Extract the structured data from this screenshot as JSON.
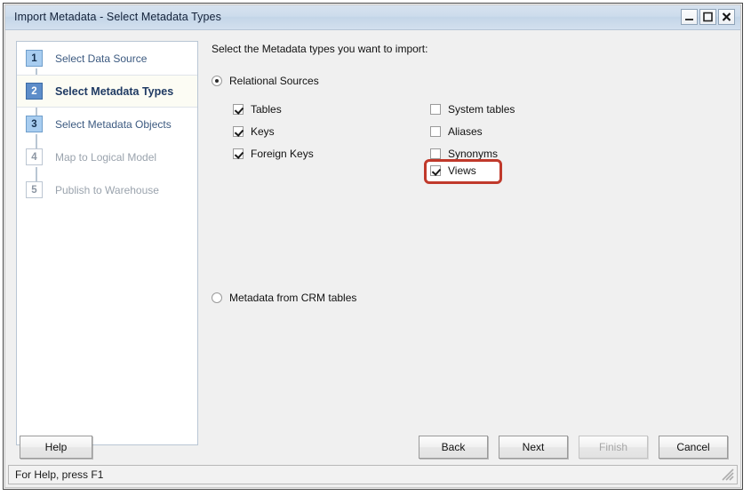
{
  "window": {
    "title": "Import Metadata - Select Metadata Types",
    "minimize_label": "Minimize",
    "maximize_label": "Maximize",
    "close_label": "Close"
  },
  "steps": [
    {
      "number": "1",
      "label": "Select Data Source",
      "state": "done"
    },
    {
      "number": "2",
      "label": "Select Metadata Types",
      "state": "active"
    },
    {
      "number": "3",
      "label": "Select Metadata Objects",
      "state": "done"
    },
    {
      "number": "4",
      "label": "Map to Logical Model",
      "state": "upcoming"
    },
    {
      "number": "5",
      "label": "Publish to Warehouse",
      "state": "upcoming"
    }
  ],
  "main": {
    "instruction": "Select the Metadata types you want to import:",
    "radios": [
      {
        "label": "Relational Sources",
        "checked": true
      },
      {
        "label": "Metadata from CRM tables",
        "checked": false
      }
    ],
    "checkboxes_left": [
      {
        "label": "Tables",
        "checked": true
      },
      {
        "label": "Keys",
        "checked": true
      },
      {
        "label": "Foreign Keys",
        "checked": true
      }
    ],
    "checkboxes_right": [
      {
        "label": "System tables",
        "checked": false
      },
      {
        "label": "Aliases",
        "checked": false
      },
      {
        "label": "Synonyms",
        "checked": false
      },
      {
        "label": "Views",
        "checked": true,
        "highlighted": true
      }
    ]
  },
  "buttons": {
    "help": {
      "label": "Help",
      "disabled": false
    },
    "back": {
      "label": "Back",
      "disabled": false
    },
    "next": {
      "label": "Next",
      "disabled": false
    },
    "finish": {
      "label": "Finish",
      "disabled": true
    },
    "cancel": {
      "label": "Cancel",
      "disabled": false
    }
  },
  "statusbar": {
    "text": "For Help, press F1"
  },
  "colors": {
    "highlight": "#c0392b",
    "titlebar": "#cddcec",
    "badge_active": "#5d8dc9",
    "badge_done": "#a8cdf0"
  }
}
